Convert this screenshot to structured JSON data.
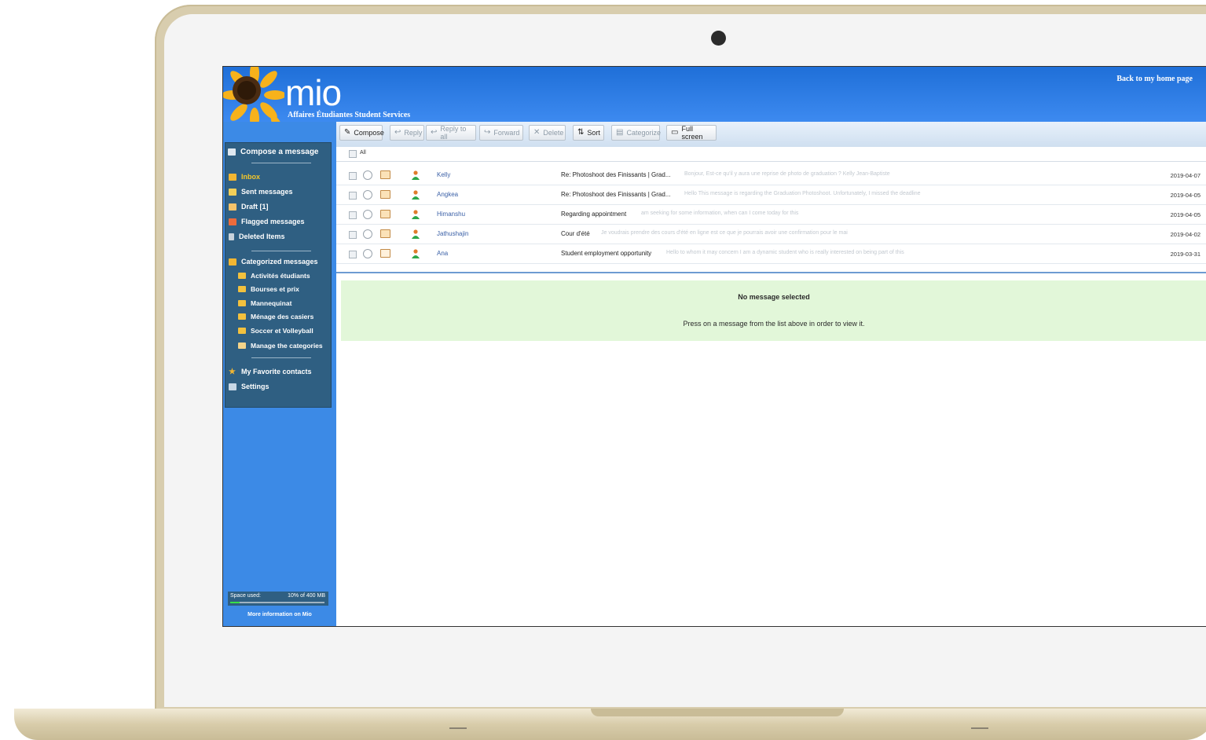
{
  "app": {
    "logo": "mio",
    "subtitle": "Affaires Étudiantes Student Services",
    "back_link": "Back to my home page"
  },
  "toolbar": {
    "compose": "Compose",
    "reply": "Reply",
    "reply_all": "Reply to all",
    "forward": "Forward",
    "delete": "Delete",
    "sort": "Sort",
    "categorize": "Categorize",
    "full_screen": "Full screen"
  },
  "sidebar": {
    "compose": "Compose a message",
    "inbox": "Inbox",
    "sent": "Sent messages",
    "draft": "Draft [1]",
    "flagged": "Flagged messages",
    "deleted": "Deleted Items",
    "categorized": "Categorized messages",
    "categories": [
      "Activités étudiants",
      "Bourses et prix",
      "Mannequinat",
      "Ménage des casiers",
      "Soccer et Volleyball"
    ],
    "manage_categories": "Manage the categories",
    "favorites": "My Favorite contacts",
    "settings": "Settings",
    "space_used_label": "Space used:",
    "space_used_value": "10% of 400 MB",
    "space_used_fraction": 0.1,
    "more_info": "More information on Mio"
  },
  "list": {
    "all_label": "All",
    "messages": [
      {
        "sender": "Kelly",
        "subject": "Re: Photoshoot des Finissants | Grad...",
        "preview": "Bonjour, Est-ce qu'il y aura une reprise de photo de graduation ? Kelly Jean-Baptiste",
        "date": "2019-04-07"
      },
      {
        "sender": "Angkea",
        "subject": "Re: Photoshoot des Finissants | Grad...",
        "preview": "Hello This message is regarding the Graduation Photoshoot. Unfortunately, I missed the deadline",
        "date": "2019-04-05"
      },
      {
        "sender": "Himanshu",
        "subject": "Regarding appointment",
        "preview": "am seeking for some information, when can I come today for this",
        "date": "2019-04-05"
      },
      {
        "sender": "Jathushajin",
        "subject": "Cour d'été",
        "preview": "Je voudrais prendre des cours d'été en ligne est ce que je pourrais avoir une confirmation pour le mai",
        "date": "2019-04-02"
      },
      {
        "sender": "Ana",
        "subject": "Student employment opportunity",
        "preview": "Hello to whom it may concern I am a dynamic student who is really interested on being part of this",
        "date": "2019-03-31"
      }
    ]
  },
  "preview_pane": {
    "title": "No message selected",
    "hint": "Press on a message from the list above in order to view it."
  }
}
